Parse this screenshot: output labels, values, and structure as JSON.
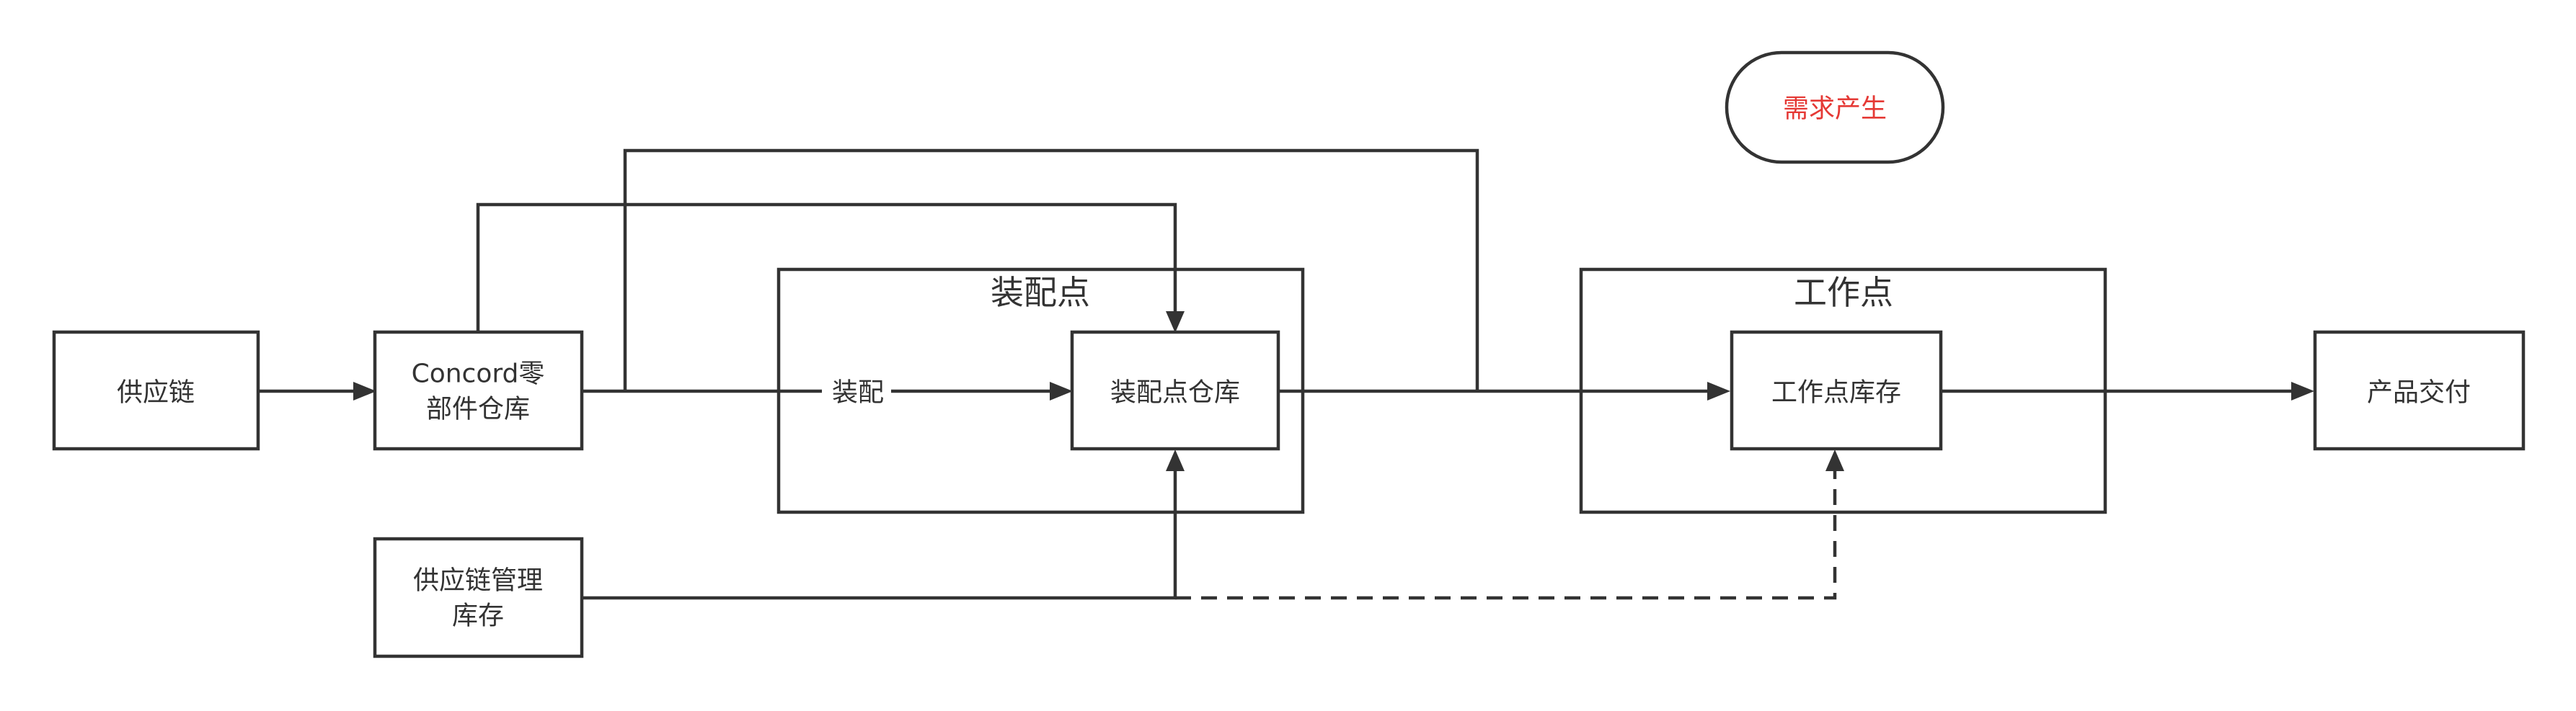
{
  "nodes": {
    "supply_chain": "供应链",
    "concord_l1": "Concord零",
    "concord_l2": "部件仓库",
    "scm_l1": "供应链管理",
    "scm_l2": "库存",
    "assembly_wh": "装配点仓库",
    "work_inv": "工作点库存",
    "delivery": "产品交付",
    "demand": "需求产生"
  },
  "groups": {
    "assembly": "装配点",
    "work": "工作点"
  },
  "edges": {
    "assemble_label": "装配"
  },
  "colors": {
    "stroke": "#333333",
    "demand_text": "#e53935"
  }
}
